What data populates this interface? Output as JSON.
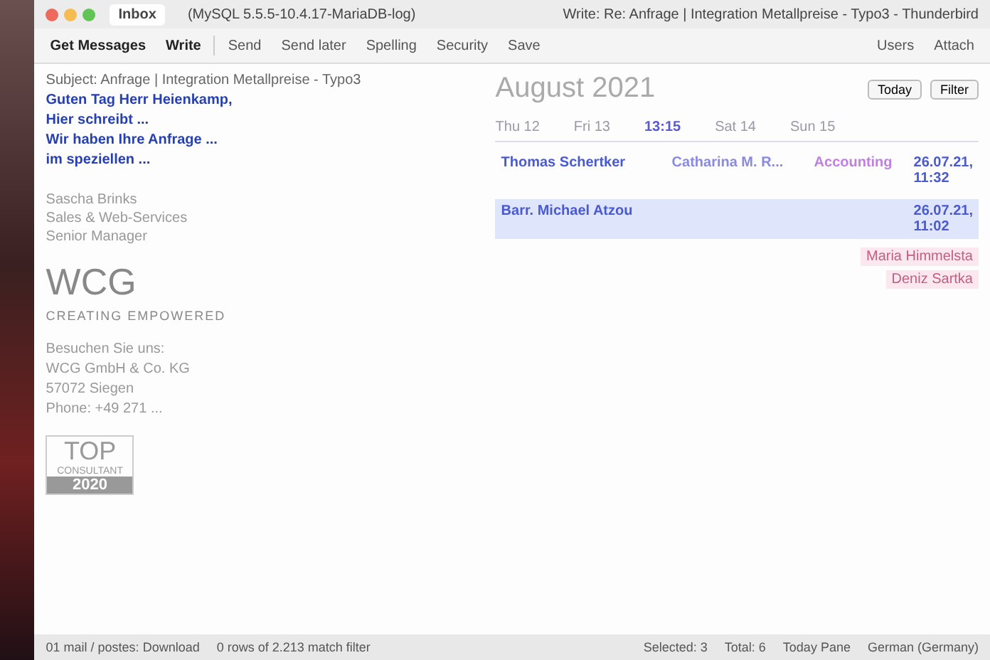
{
  "window": {
    "tabs": [
      {
        "label": "Inbox",
        "selected": true
      },
      {
        "label": "(MySQL 5.5.5-10.4.17-MariaDB-log)",
        "selected": false
      }
    ],
    "title": "Write: Re: Anfrage | Integration Metallpreise - Typo3 - Thunderbird"
  },
  "toolbar": {
    "left": [
      "Get Messages",
      "Write"
    ],
    "compose": [
      "Send",
      "Send later",
      "Spelling",
      "Security",
      "Save"
    ],
    "right": [
      "Users",
      "Attach"
    ]
  },
  "email": {
    "header": [
      "Subject: Anfrage | Integration Metallpreise - Typo3"
    ],
    "greeting": "Guten Tag Herr Heienkamp,",
    "lines": [
      "Hier schreibt ...",
      "Wir haben Ihre Anfrage ...",
      "im speziellen ..."
    ],
    "signature": [
      "Sascha Brinks",
      "Sales & Web-Services",
      "Senior Manager"
    ],
    "logo": "WCG",
    "logo_tagline": "CREATING EMPOWERED",
    "footer": [
      "Besuchen Sie uns:",
      "WCG GmbH & Co. KG",
      "57072 Siegen",
      "Phone: +49 271 ..."
    ],
    "badge_title": "TOP",
    "badge_sub": "CONSULTANT",
    "badge_year": "2020"
  },
  "calendar": {
    "month": "August 2021",
    "today": "Today",
    "filter": "Filter",
    "days": [
      {
        "label": "Thu 12"
      },
      {
        "label": "Fri 13"
      },
      {
        "label": "Sat 14"
      },
      {
        "label": "Sun 15"
      }
    ],
    "time": "13:15",
    "rows": [
      {
        "name": "Thomas Schertker",
        "contact": "Catharina M. R...",
        "category": "Accounting",
        "date": "26.07.21, 11:32",
        "selected": false
      },
      {
        "name": "Barr. Michael Atzou",
        "contact": "",
        "category": "",
        "date": "26.07.21, 11:02",
        "selected": true
      }
    ],
    "side": [
      "Maria Himmelsta",
      "Deniz Sartka"
    ]
  },
  "status_bar": {
    "left": "01 mail / postes: Download",
    "rows": "0 rows of 2.213 match filter",
    "selected": "Selected: 3",
    "total": "Total: 6",
    "pane": "Today Pane",
    "language": "German (Germany)"
  }
}
